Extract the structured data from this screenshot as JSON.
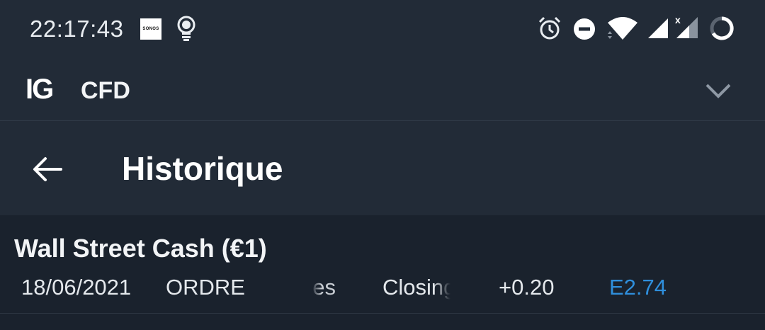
{
  "status_bar": {
    "time": "22:17:43",
    "sonos_text": "SONOS",
    "icons": [
      "sonos-icon",
      "lightbulb-icon",
      "alarm-icon",
      "do-not-disturb-icon",
      "wifi-icon",
      "signal-icon",
      "signal-no-data-icon",
      "battery-ring-icon"
    ],
    "no_data_mark": "x"
  },
  "app_bar": {
    "logo": "IG",
    "account": "CFD",
    "dropdown_icon": "chevron-down-icon"
  },
  "header": {
    "back_icon": "arrow-left-icon",
    "title": "Historique"
  },
  "history": {
    "rows": [
      {
        "instrument": "Wall Street Cash (€1)",
        "date": "18/06/2021",
        "type": "ORDRE",
        "col3": "es",
        "col4": "Closing",
        "change": "+0.20",
        "pl": "E2.74"
      }
    ]
  },
  "colors": {
    "background": "#1a222d",
    "bar": "#222b37",
    "accent_blue": "#2f8fdc"
  }
}
